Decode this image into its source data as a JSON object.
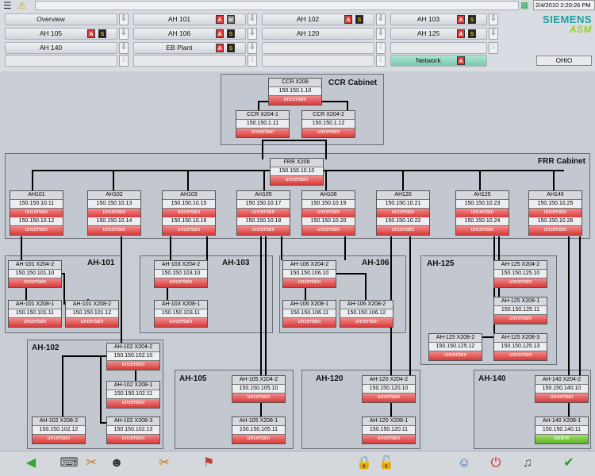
{
  "header": {
    "datetime": "2/4/2010 2:20:26 PM",
    "brand": "SIEMENS",
    "brand_sub": "ASM",
    "site": "OHIO",
    "nav": [
      {
        "label": "Overview"
      },
      {
        "label": "AH 101"
      },
      {
        "label": "AH 102"
      },
      {
        "label": "AH 103"
      },
      {
        "label": "AH 105"
      },
      {
        "label": "AH 106"
      },
      {
        "label": "AH 120"
      },
      {
        "label": "AH 125"
      },
      {
        "label": "AH 140"
      },
      {
        "label": "EB Plant"
      },
      {
        "label": ""
      },
      {
        "label": ""
      },
      {
        "label": ""
      },
      {
        "label": ""
      },
      {
        "label": ""
      },
      {
        "label": "Network"
      }
    ]
  },
  "cabinets": {
    "ccr": "CCR Cabinet",
    "frr": "FRR Cabinet",
    "ah101": "AH-101",
    "ah102": "AH-102",
    "ah103": "AH-103",
    "ah105": "AH-105",
    "ah106": "AH-106",
    "ah120": "AH-120",
    "ah125": "AH-125",
    "ah140": "AH-140"
  },
  "devices": {
    "ccr_x208": {
      "name": "CCR X208",
      "ip": "150.150.1.10",
      "status": "uncertain"
    },
    "ccr_x204_1": {
      "name": "CCR X204-1",
      "ip": "150.150.1.11",
      "status": "uncertain"
    },
    "ccr_x204_2": {
      "name": "CCR X204-2",
      "ip": "150.150.1.12",
      "status": "uncertain"
    },
    "frr_x208": {
      "name": "FRR X208",
      "ip": "150.150.10.10",
      "status": "uncertain"
    },
    "ah101": {
      "name": "AH101",
      "ip": "150.150.10.11",
      "status": "uncertain",
      "ip2": "150.150.10.12",
      "status2": "uncertain"
    },
    "ah102": {
      "name": "AH102",
      "ip": "150.150.10.13",
      "status": "uncertain",
      "ip2": "150.150.10.14",
      "status2": "uncertain"
    },
    "ah103": {
      "name": "AH103",
      "ip": "150.150.10.15",
      "status": "uncertain",
      "ip2": "150.150.10.16",
      "status2": "uncertain"
    },
    "ah105": {
      "name": "AH105",
      "ip": "150.150.10.17",
      "status": "uncertain",
      "ip2": "150.150.10.18",
      "status2": "uncertain"
    },
    "ah106": {
      "name": "AH106",
      "ip": "150.150.10.19",
      "status": "uncertain",
      "ip2": "150.150.10.20",
      "status2": "uncertain"
    },
    "ah120": {
      "name": "AH120",
      "ip": "150.150.10.21",
      "status": "uncertain",
      "ip2": "150.150.10.22",
      "status2": "uncertain"
    },
    "ah125": {
      "name": "AH125",
      "ip": "150.150.10.23",
      "status": "uncertain",
      "ip2": "150.150.10.24",
      "status2": "uncertain"
    },
    "ah140": {
      "name": "AH140",
      "ip": "150.150.10.25",
      "status": "uncertain",
      "ip2": "150.150.10.26",
      "status2": "uncertain"
    },
    "ah101_x204_2": {
      "name": "AH-101 X204-2",
      "ip": "150.150.101.10",
      "status": "uncertain"
    },
    "ah101_x208_1": {
      "name": "AH-101 X208-1",
      "ip": "150.150.101.11",
      "status": "uncertain"
    },
    "ah101_x208_2": {
      "name": "AH-101 X208-2",
      "ip": "150.150.101.12",
      "status": "uncertain"
    },
    "ah103_x204_2": {
      "name": "AH-103 X204-2",
      "ip": "150.150.103.10",
      "status": "uncertain"
    },
    "ah103_x208_1": {
      "name": "AH-103 X208-1",
      "ip": "150.150.103.11",
      "status": "uncertain"
    },
    "ah106_x204_2": {
      "name": "AH-106 X204-2",
      "ip": "150.150.106.10",
      "status": "uncertain"
    },
    "ah106_x208_1": {
      "name": "AH-106 X208-1",
      "ip": "150.150.106.11",
      "status": "uncertain"
    },
    "ah106_x208_2": {
      "name": "AH-106 X208-2",
      "ip": "150.150.106.12",
      "status": "uncertain"
    },
    "ah125_x204_2": {
      "name": "AH-125 X204-2",
      "ip": "150.150.125.10",
      "status": "uncertain"
    },
    "ah125_x208_1": {
      "name": "AH-125 X208-1",
      "ip": "150.150.125.11",
      "status": "uncertain"
    },
    "ah125_x208_2": {
      "name": "AH-125 X208-2",
      "ip": "150.150.125.12",
      "status": "uncertain"
    },
    "ah125_x208_3": {
      "name": "AH-125 X208-3",
      "ip": "150.150.125.13",
      "status": "uncertain"
    },
    "ah102_x204_2": {
      "name": "AH-102 X204-2",
      "ip": "150.150.102.10",
      "status": "uncertain"
    },
    "ah102_x208_1": {
      "name": "AH-102 X208-1",
      "ip": "150.150.102.11",
      "status": "uncertain"
    },
    "ah102_x208_2": {
      "name": "AH-102 X208-2",
      "ip": "150.150.102.12",
      "status": "uncertain"
    },
    "ah102_x208_3": {
      "name": "AH-102 X208-3",
      "ip": "150.150.102.13",
      "status": "uncertain"
    },
    "ah105_x204_2": {
      "name": "AH-105 X204-2",
      "ip": "150.150.105.10",
      "status": "uncertain"
    },
    "ah105_x208_1": {
      "name": "AH-105 X208-1",
      "ip": "150.150.105.11",
      "status": "uncertain"
    },
    "ah120_x204_2": {
      "name": "AH-120 X204-2",
      "ip": "150.150.120.10",
      "status": "uncertain"
    },
    "ah120_x208_1": {
      "name": "AH-120 X208-1",
      "ip": "150.150.120.11",
      "status": "uncertain"
    },
    "ah140_x204_2": {
      "name": "AH-140 X204-2",
      "ip": "150.150.140.10",
      "status": "uncertain"
    },
    "ah140_x208_1": {
      "name": "AH-140 X208-1",
      "ip": "150.150.140.11",
      "status": "online"
    }
  },
  "colors": {
    "uncertain": "#d93a3a",
    "online": "#5cb52c",
    "brand": "#1aa3a3"
  },
  "footer_icons": [
    "back-arrow-icon",
    "keyboard-icon",
    "tools-icon",
    "users-icon",
    "settings-tools-icon",
    "flag-icon",
    "lock-icon",
    "unlock-icon",
    "user-login-icon",
    "power-icon",
    "sound-icon",
    "acknowledge-icon"
  ]
}
